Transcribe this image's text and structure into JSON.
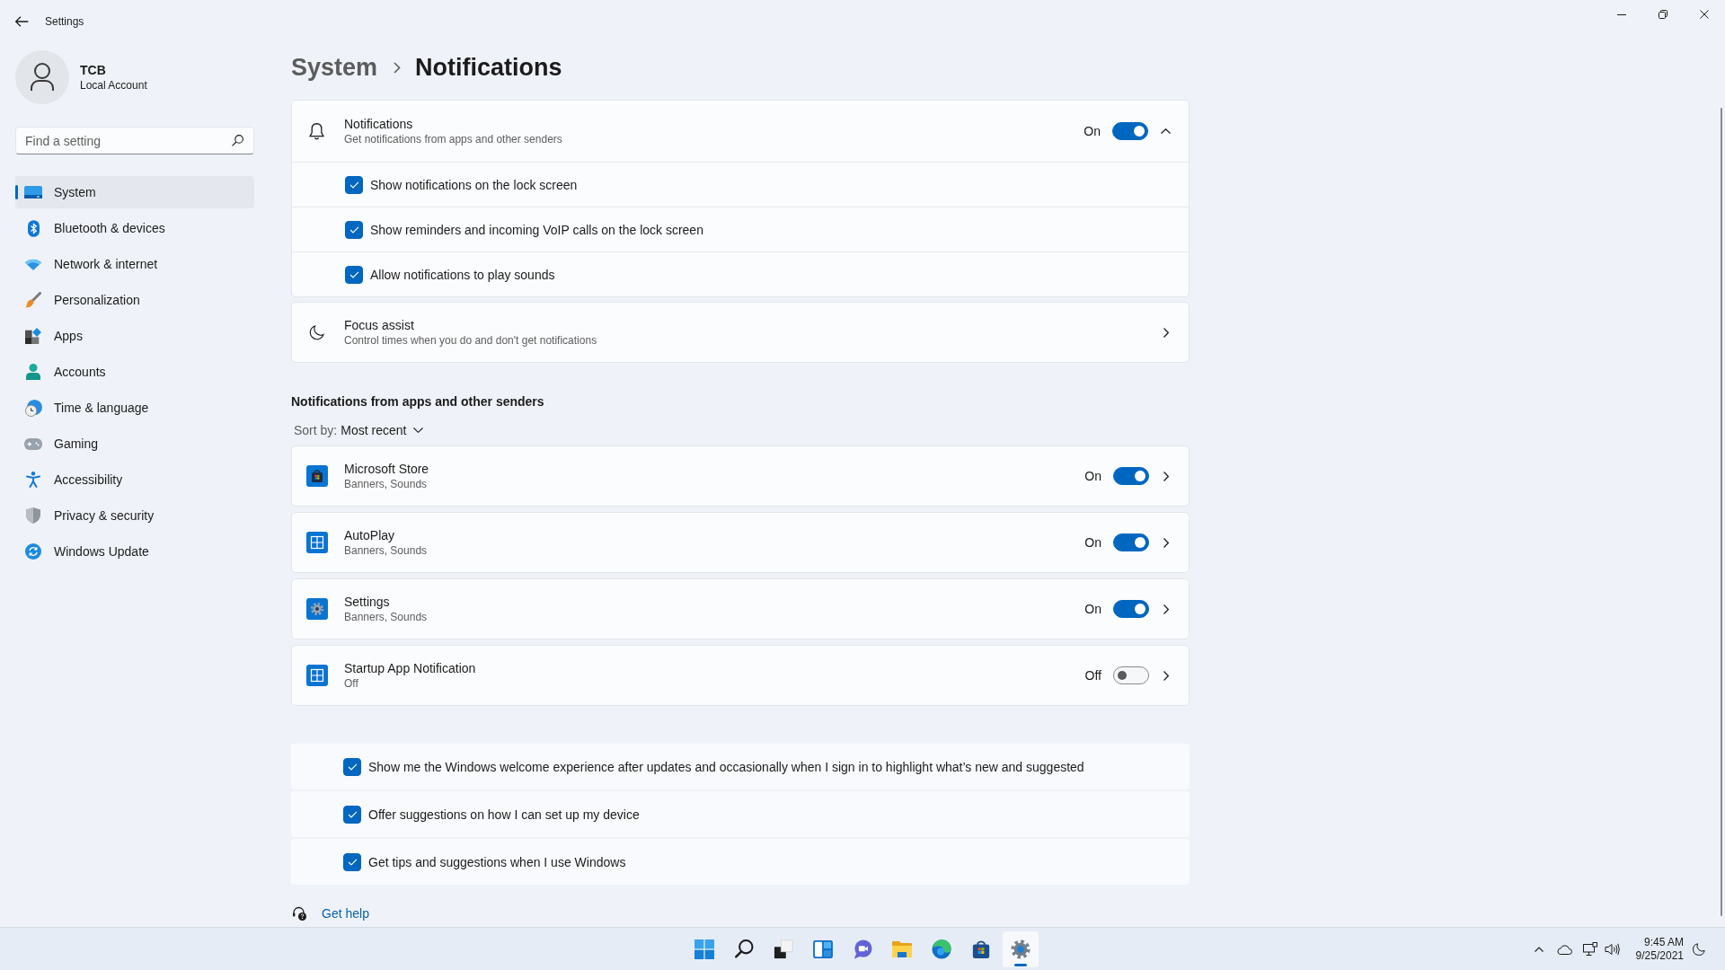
{
  "window": {
    "title": "Settings"
  },
  "account": {
    "name": "TCB",
    "type": "Local Account"
  },
  "search": {
    "placeholder": "Find a setting"
  },
  "sidebar": {
    "items": [
      {
        "label": "System",
        "selected": true
      },
      {
        "label": "Bluetooth & devices",
        "selected": false
      },
      {
        "label": "Network & internet",
        "selected": false
      },
      {
        "label": "Personalization",
        "selected": false
      },
      {
        "label": "Apps",
        "selected": false
      },
      {
        "label": "Accounts",
        "selected": false
      },
      {
        "label": "Time & language",
        "selected": false
      },
      {
        "label": "Gaming",
        "selected": false
      },
      {
        "label": "Accessibility",
        "selected": false
      },
      {
        "label": "Privacy & security",
        "selected": false
      },
      {
        "label": "Windows Update",
        "selected": false
      }
    ]
  },
  "breadcrumb": {
    "parent": "System",
    "current": "Notifications"
  },
  "notifications": {
    "title": "Notifications",
    "description": "Get notifications from apps and other senders",
    "state_label": "On",
    "on": true,
    "expanded": true,
    "options": [
      {
        "label": "Show notifications on the lock screen",
        "checked": true
      },
      {
        "label": "Show reminders and incoming VoIP calls on the lock screen",
        "checked": true
      },
      {
        "label": "Allow notifications to play sounds",
        "checked": true
      }
    ]
  },
  "focus_assist": {
    "title": "Focus assist",
    "description": "Control times when you do and don't get notifications"
  },
  "senders": {
    "heading": "Notifications from apps and other senders",
    "sort_label": "Sort by:",
    "sort_value": "Most recent",
    "apps": [
      {
        "name": "Microsoft Store",
        "detail": "Banners, Sounds",
        "state_label": "On",
        "on": true
      },
      {
        "name": "AutoPlay",
        "detail": "Banners, Sounds",
        "state_label": "On",
        "on": true
      },
      {
        "name": "Settings",
        "detail": "Banners, Sounds",
        "state_label": "On",
        "on": true
      },
      {
        "name": "Startup App Notification",
        "detail": "Off",
        "state_label": "Off",
        "on": false
      }
    ]
  },
  "extra_options": [
    {
      "label": "Show me the Windows welcome experience after updates and occasionally when I sign in to highlight what’s new and suggested",
      "checked": true
    },
    {
      "label": "Offer suggestions on how I can set up my device",
      "checked": true
    },
    {
      "label": "Get tips and suggestions when I use Windows",
      "checked": true
    }
  ],
  "get_help": "Get help",
  "taskbar": {
    "items": [
      {
        "selected": false
      },
      {
        "selected": false
      },
      {
        "selected": false
      },
      {
        "selected": false
      },
      {
        "selected": false
      },
      {
        "selected": false
      },
      {
        "selected": false
      },
      {
        "selected": false
      },
      {
        "selected": true
      }
    ],
    "time": "9:45 AM",
    "date": "9/25/2021"
  }
}
